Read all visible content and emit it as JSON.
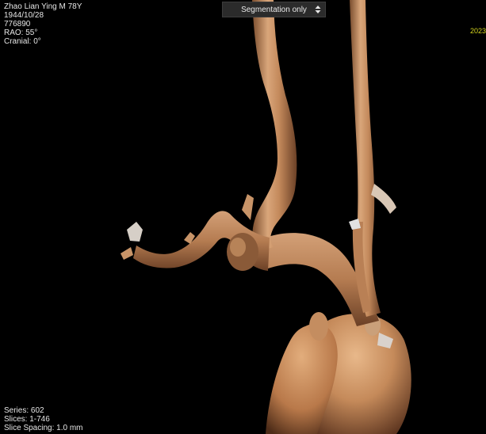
{
  "patient": {
    "name_line": "Zhao Lian Ying  M  78Y",
    "birth_date": "1944/10/28",
    "patient_id": "776890",
    "rao": "RAO: 55°",
    "cranial": "Cranial: 0°"
  },
  "render_mode": {
    "selected": "Segmentation only"
  },
  "corner_date": "2023",
  "series": {
    "series": "Series: 602",
    "slices": "Slices: 1-746",
    "spacing": "Slice Spacing: 1.0 mm"
  },
  "colors": {
    "background": "#000000",
    "vessel": "#c9956a",
    "corner_text": "#d6d61e"
  }
}
